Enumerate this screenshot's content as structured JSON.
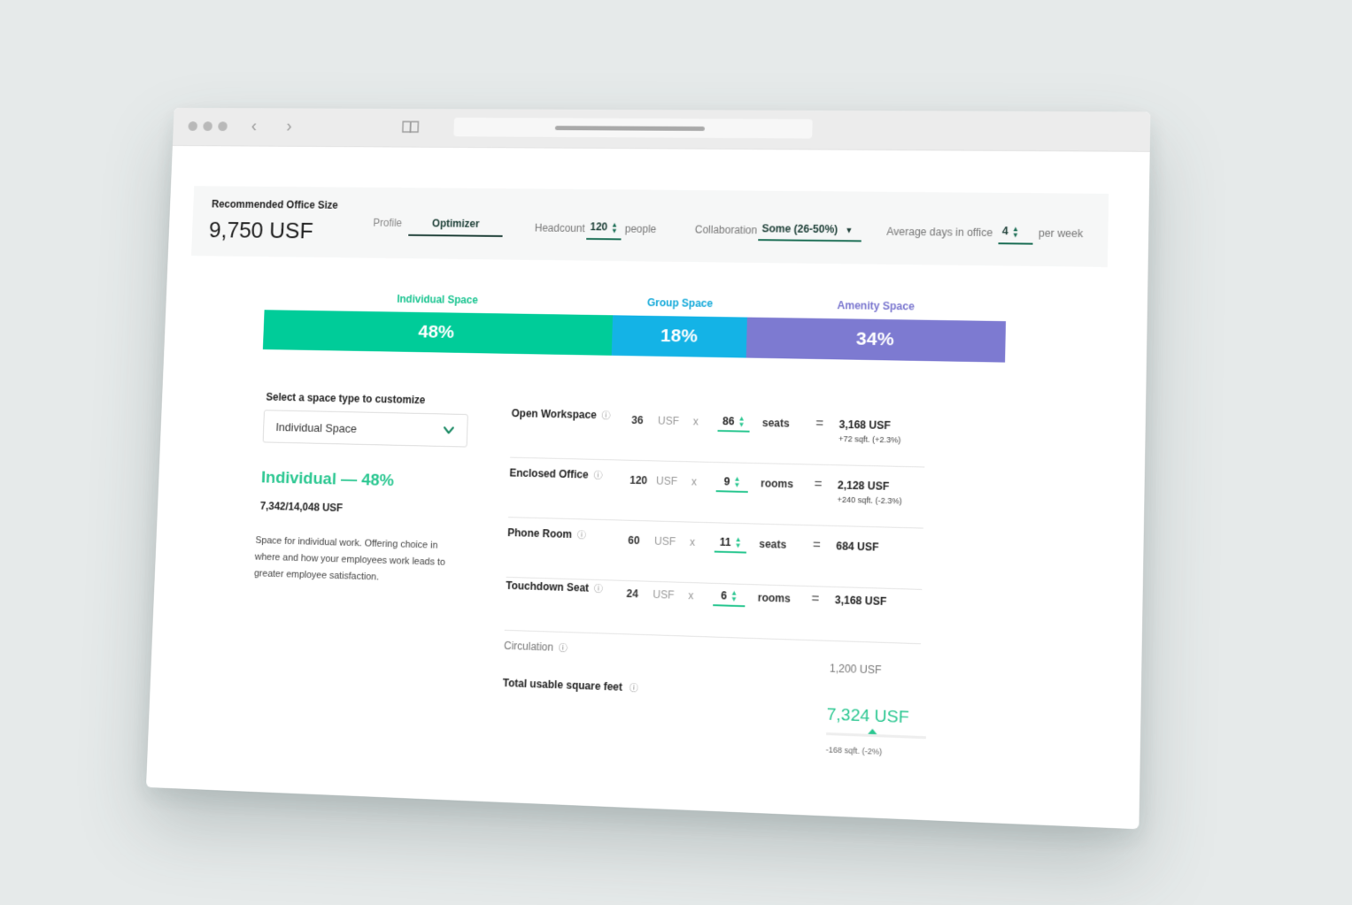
{
  "header": {
    "recommended_label": "Recommended Office Size",
    "recommended_value": "9,750 USF",
    "tabs": [
      {
        "label": "Profile",
        "active": false
      },
      {
        "label": "Optimizer",
        "active": true
      }
    ],
    "headcount": {
      "label": "Headcount",
      "value": "120",
      "unit": "people"
    },
    "collaboration": {
      "label": "Collaboration",
      "value": "Some (26-50%)"
    },
    "days": {
      "label": "Average days in office",
      "value": "4",
      "unit": "per week"
    }
  },
  "distribution": {
    "segments": [
      {
        "label": "Individual Space",
        "value_text": "48%",
        "percent": 48,
        "color": "#00cc99",
        "label_color": "#19c490"
      },
      {
        "label": "Group Space",
        "value_text": "18%",
        "percent": 18,
        "color": "#14b3e6",
        "label_color": "#12a9d9"
      },
      {
        "label": "Amenity Space",
        "value_text": "34%",
        "percent": 34,
        "color": "#7d7ad1",
        "label_color": "#7a76cf"
      }
    ]
  },
  "panel": {
    "select_label": "Select a space type to customize",
    "select_value": "Individual Space",
    "title": "Individual — 48%",
    "usf": "7,342/14,048 USF",
    "description": "Space for individual work. Offering choice in where and how your employees work leads to greater employee satisfaction."
  },
  "rows": [
    {
      "name": "Open Workspace",
      "rate": "36",
      "rate_unit": "USF",
      "times": "x",
      "qty": "86",
      "unit": "seats",
      "eq": "=",
      "total": "3,168 USF",
      "delta": "+72 sqft. (+2.3%)"
    },
    {
      "name": "Enclosed Office",
      "rate": "120",
      "rate_unit": "USF",
      "times": "x",
      "qty": "9",
      "unit": "rooms",
      "eq": "=",
      "total": "2,128 USF",
      "delta": "+240 sqft. (-2.3%)"
    },
    {
      "name": "Phone Room",
      "rate": "60",
      "rate_unit": "USF",
      "times": "x",
      "qty": "11",
      "unit": "seats",
      "eq": "=",
      "total": "684 USF",
      "delta": ""
    },
    {
      "name": "Touchdown Seat",
      "rate": "24",
      "rate_unit": "USF",
      "times": "x",
      "qty": "6",
      "unit": "rooms",
      "eq": "=",
      "total": "3,168 USF",
      "delta": ""
    }
  ],
  "circulation": {
    "label": "Circulation",
    "value": "1,200 USF"
  },
  "total": {
    "label": "Total usable square feet",
    "value": "7,324 USF",
    "delta": "-168 sqft. (-2%)"
  },
  "colors": {
    "accent": "#2bc791",
    "dark_accent": "#1b3d35"
  }
}
